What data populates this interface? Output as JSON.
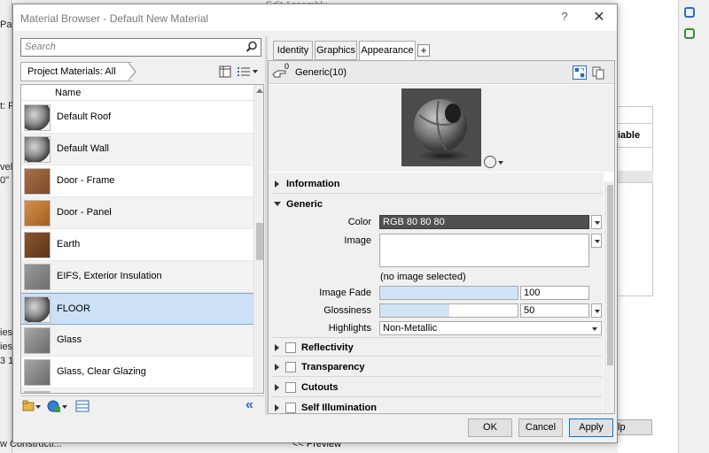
{
  "background": {
    "edit_assembly_title": "Edit Assembly",
    "left_fragments": [
      "Pas",
      "t: Flo",
      "vel",
      "0\"",
      "ies",
      "ies",
      "3 1",
      "w Constructi..."
    ],
    "right_header": "iable",
    "help_label": "lp",
    "preview_label": "<< Preview"
  },
  "dialog": {
    "title": "Material Browser - Default New Material",
    "help_glyph": "?",
    "close_glyph": "✕"
  },
  "left": {
    "search_placeholder": "Search",
    "breadcrumb": "Project Materials: All",
    "column_header": "Name",
    "materials": [
      {
        "name": "Default Roof",
        "thumb": "sphere"
      },
      {
        "name": "Default Wall",
        "thumb": "sphere"
      },
      {
        "name": "Door - Frame",
        "thumb": "wood-warm"
      },
      {
        "name": "Door - Panel",
        "thumb": "wood-orange"
      },
      {
        "name": "Earth",
        "thumb": "earth"
      },
      {
        "name": "EIFS, Exterior Insulation",
        "thumb": "gray"
      },
      {
        "name": "FLOOR",
        "thumb": "sphere"
      },
      {
        "name": "Glass",
        "thumb": "glass"
      },
      {
        "name": "Glass, Clear Glazing",
        "thumb": "glass"
      },
      {
        "name": "",
        "thumb": "partial"
      }
    ],
    "selected_index": 6,
    "collapse_glyph": "«"
  },
  "tabs": [
    {
      "label": "Identity",
      "active": false
    },
    {
      "label": "Graphics",
      "active": false
    },
    {
      "label": "Appearance",
      "active": true
    }
  ],
  "tab_add_glyph": "+",
  "asset": {
    "count": "0",
    "name": "Generic(10)"
  },
  "sections": {
    "information": "Information",
    "generic": "Generic",
    "reflectivity": "Reflectivity",
    "transparency": "Transparency",
    "cutouts": "Cutouts",
    "self_illumination": "Self Illumination"
  },
  "generic": {
    "color_label": "Color",
    "color_value": "RGB 80 80 80",
    "image_label": "Image",
    "image_note": "(no image selected)",
    "image_fade_label": "Image Fade",
    "image_fade_value": "100",
    "image_fade_fraction": 1.0,
    "glossiness_label": "Glossiness",
    "glossiness_value": "50",
    "glossiness_fraction": 0.5,
    "highlights_label": "Highlights",
    "highlights_value": "Non-Metallic"
  },
  "footer": {
    "ok": "OK",
    "cancel": "Cancel",
    "apply": "Apply"
  },
  "colors": {
    "color_swatch": "#505050",
    "selection": "#cce0f6",
    "slider_fill": "#cfe4f7",
    "accent": "#0078d7"
  }
}
